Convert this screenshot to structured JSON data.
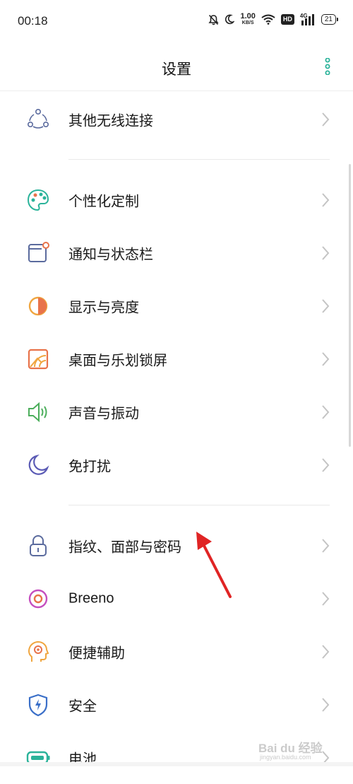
{
  "status_bar": {
    "time": "00:18",
    "net_speed_value": "1.00",
    "net_speed_unit": "KB/S",
    "hd": "HD",
    "signal_type": "4G",
    "battery": "21"
  },
  "header": {
    "title": "设置",
    "more_icon": "vertical-dots-icon"
  },
  "colors": {
    "accent": "#2bb39a",
    "annotation": "#e02424"
  },
  "rows": [
    {
      "label": "其他无线连接",
      "icon": "wireless-connection-icon"
    },
    {
      "label": "个性化定制",
      "icon": "palette-icon"
    },
    {
      "label": "通知与状态栏",
      "icon": "notification-icon"
    },
    {
      "label": "显示与亮度",
      "icon": "brightness-icon"
    },
    {
      "label": "桌面与乐划锁屏",
      "icon": "wallpaper-icon"
    },
    {
      "label": "声音与振动",
      "icon": "speaker-icon"
    },
    {
      "label": "免打扰",
      "icon": "moon-icon"
    },
    {
      "label": "指纹、面部与密码",
      "icon": "lock-icon"
    },
    {
      "label": "Breeno",
      "icon": "breeno-icon"
    },
    {
      "label": "便捷辅助",
      "icon": "assistant-icon"
    },
    {
      "label": "安全",
      "icon": "shield-icon"
    },
    {
      "label": "电池",
      "icon": "battery-icon"
    }
  ],
  "watermark": {
    "text": "Bai du 经验",
    "subtext": "jingyan.baidu.com"
  }
}
